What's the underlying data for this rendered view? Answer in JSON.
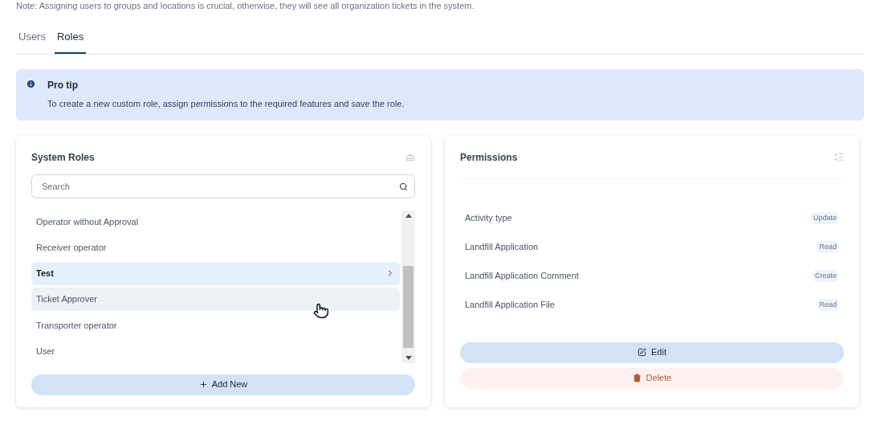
{
  "note": "Note: Assigning users to groups and locations is crucial, otherwise, they will see all organization tickets in the system.",
  "tabs": [
    {
      "label": "Users",
      "selected": false
    },
    {
      "label": "Roles",
      "selected": true
    }
  ],
  "tip": {
    "title": "Pro tip",
    "text": "To create a new custom role, assign permissions to the required features and save the role."
  },
  "roles_panel": {
    "title": "System Roles",
    "search": {
      "placeholder": "Search"
    },
    "roles": [
      {
        "name": "Operator without Approval",
        "selected": false,
        "hovered": false
      },
      {
        "name": "Receiver operator",
        "selected": false,
        "hovered": false
      },
      {
        "name": "Test",
        "selected": true,
        "hovered": false
      },
      {
        "name": "Ticket Approver",
        "selected": false,
        "hovered": true
      },
      {
        "name": "Transporter operator",
        "selected": false,
        "hovered": false
      },
      {
        "name": "User",
        "selected": false,
        "hovered": false
      }
    ],
    "add_button": "Add New"
  },
  "permissions_panel": {
    "title": "Permissions",
    "permissions": [
      {
        "feature": "Activity type",
        "access": "Update"
      },
      {
        "feature": "Landfill Application",
        "access": "Read"
      },
      {
        "feature": "Landfill Application Comment",
        "access": "Create"
      },
      {
        "feature": "Landfill Application File",
        "access": "Read"
      }
    ],
    "edit_button": "Edit",
    "delete_button": "Delete"
  }
}
